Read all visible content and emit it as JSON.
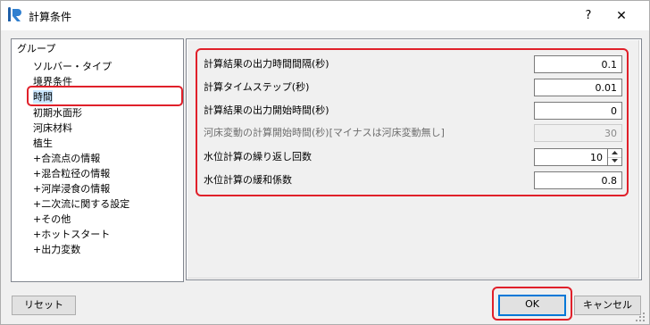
{
  "window": {
    "title": "計算条件",
    "help_label": "?",
    "close_label": "✕",
    "app_icon": "iric-app-icon",
    "accent_color": "#0078d7",
    "highlight_color": "#e0202a"
  },
  "tree": {
    "items": [
      {
        "label": "グループ"
      },
      {
        "label": "ソルバー・タイプ"
      },
      {
        "label": "境界条件"
      },
      {
        "label": "時間",
        "selected": true
      },
      {
        "label": "初期水面形"
      },
      {
        "label": "河床材料"
      },
      {
        "label": "植生"
      },
      {
        "label": "+合流点の情報"
      },
      {
        "label": "+混合粒径の情報"
      },
      {
        "label": "+河岸浸食の情報"
      },
      {
        "label": "+二次流に関する設定"
      },
      {
        "label": "+その他"
      },
      {
        "label": "+ホットスタート"
      },
      {
        "label": "+出力変数"
      }
    ]
  },
  "form": {
    "rows": [
      {
        "label": "計算結果の出力時間間隔(秒)",
        "value": "0.1"
      },
      {
        "label": "計算タイムステップ(秒)",
        "value": "0.01"
      },
      {
        "label": "計算結果の出力開始時間(秒)",
        "value": "0"
      },
      {
        "label": "河床変動の計算開始時間(秒)[マイナスは河床変動無し]",
        "value": "30",
        "disabled": true
      },
      {
        "label": "水位計算の繰り返し回数",
        "value": "10",
        "spinner": true
      },
      {
        "label": "水位計算の緩和係数",
        "value": "0.8"
      }
    ]
  },
  "buttons": {
    "reset": "リセット",
    "ok": "OK",
    "cancel": "キャンセル"
  }
}
